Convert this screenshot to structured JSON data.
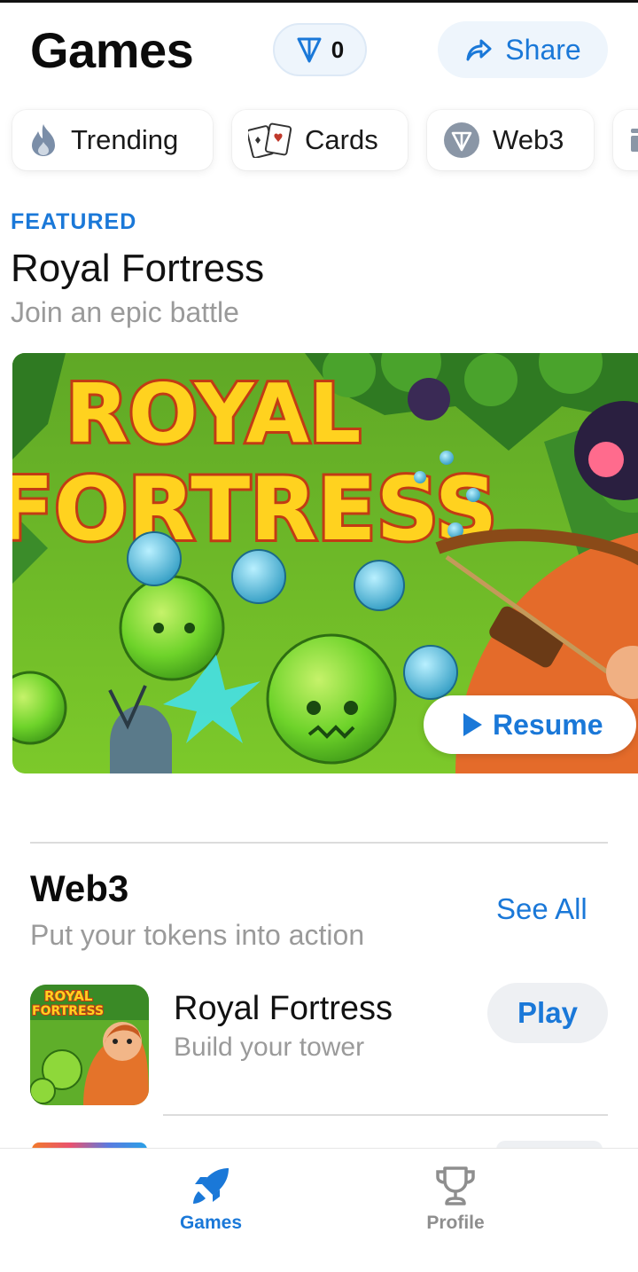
{
  "header": {
    "title": "Games",
    "balance_value": "0",
    "balance_icon": "ton-diamond-icon",
    "share_label": "Share",
    "share_icon": "share-arrow-icon"
  },
  "categories": [
    {
      "label": "Trending",
      "icon": "flame-icon"
    },
    {
      "label": "Cards",
      "icon": "playing-cards-icon"
    },
    {
      "label": "Web3",
      "icon": "ton-diamond-icon"
    }
  ],
  "featured": {
    "label": "FEATURED",
    "title": "Royal Fortress",
    "subtitle": "Join an epic battle",
    "banner_text_line1": "ROYAL",
    "banner_text_line2": "FORTRESS",
    "resume_label": "Resume",
    "resume_icon": "play-icon"
  },
  "web3_section": {
    "title": "Web3",
    "subtitle": "Put your tokens into action",
    "see_all_label": "See All",
    "games": [
      {
        "name": "Royal Fortress",
        "description": "Build your tower",
        "play_label": "Play",
        "thumb_text_line1": "ROYAL",
        "thumb_text_line2": "FORTRESS"
      }
    ]
  },
  "bottom_nav": {
    "items": [
      {
        "label": "Games",
        "icon": "rocket-icon",
        "active": true
      },
      {
        "label": "Profile",
        "icon": "trophy-icon",
        "active": false
      }
    ]
  },
  "colors": {
    "accent": "#1a78d8",
    "muted_text": "#9a9a9a",
    "pill_bg": "#eef5fc",
    "play_bg": "#eef0f3"
  }
}
